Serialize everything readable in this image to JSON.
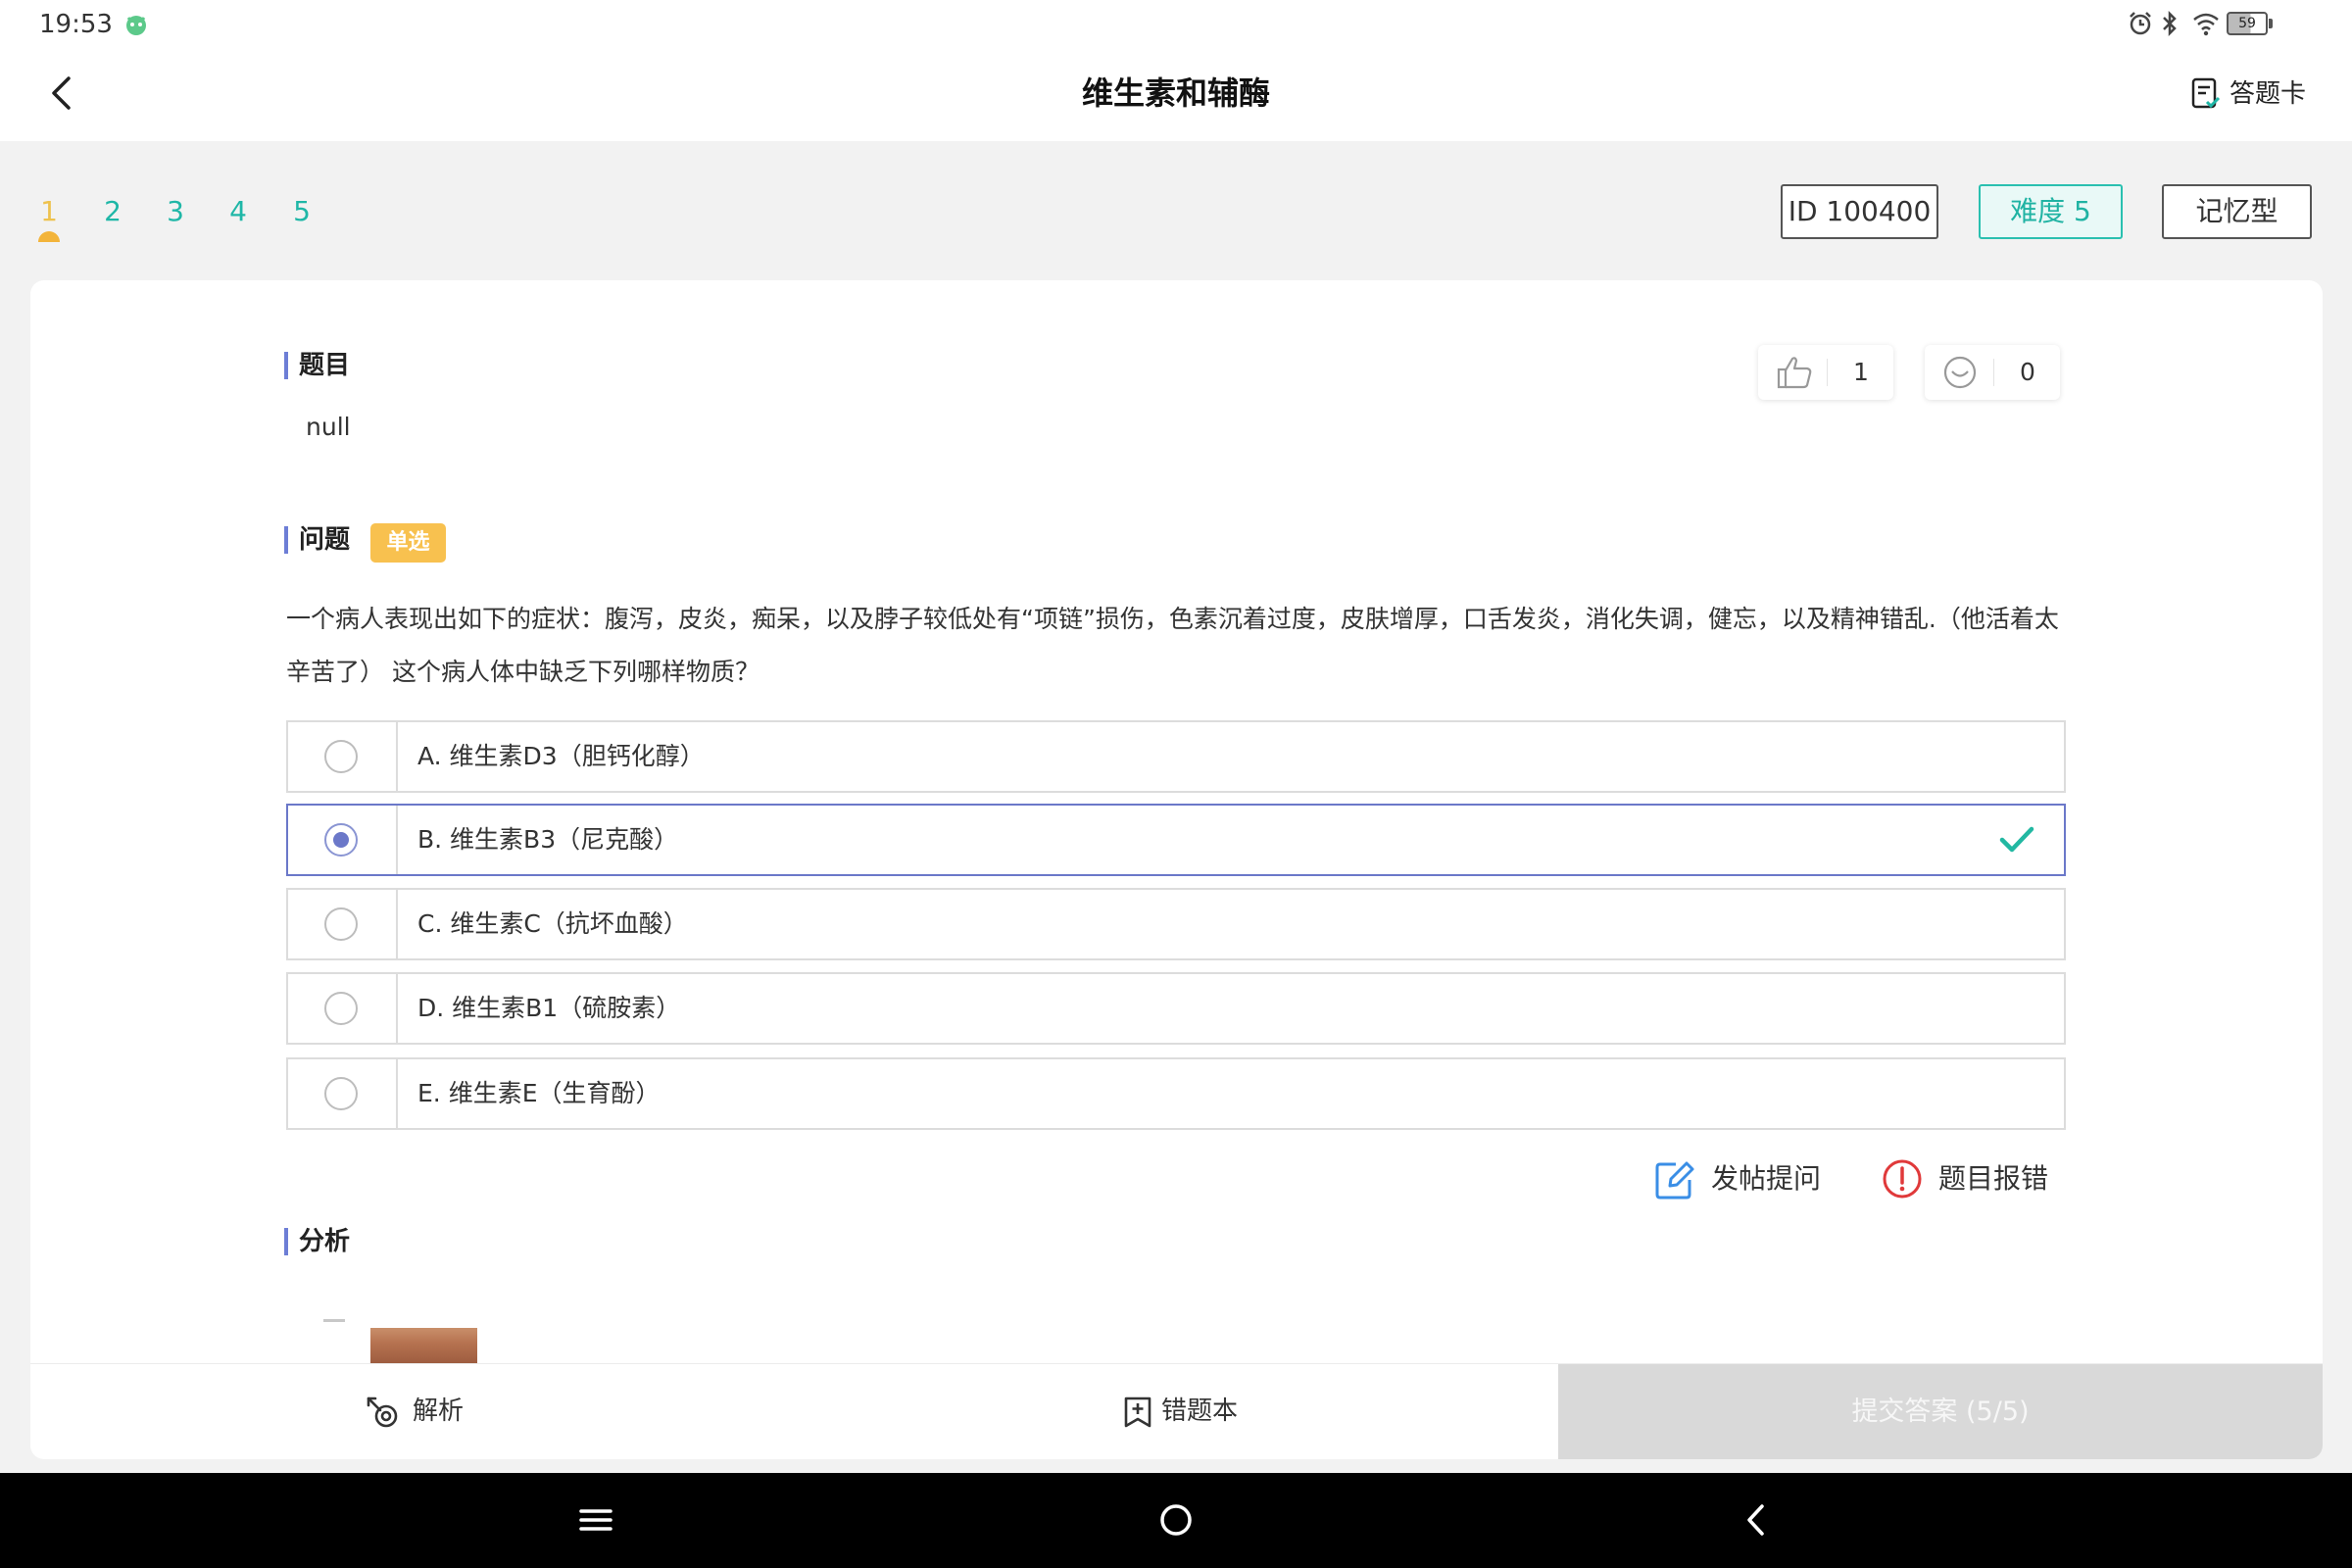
{
  "status_bar": {
    "time": "19:53",
    "battery": "59"
  },
  "header": {
    "title": "维生素和辅酶",
    "answer_card_label": "答题卡"
  },
  "question_nav": {
    "numbers": [
      "1",
      "2",
      "3",
      "4",
      "5"
    ],
    "current_index": 0
  },
  "badges": {
    "id": "ID 100400",
    "difficulty": "难度 5",
    "type": "记忆型"
  },
  "stem": {
    "label": "题目",
    "text": "null"
  },
  "reactions": {
    "likes": "1",
    "dislikes": "0"
  },
  "question": {
    "label": "问题",
    "tag": "单选",
    "text": "一个病人表现出如下的症状：腹泻，皮炎，痴呆，以及脖子较低处有“项链”损伤，色素沉着过度，皮肤增厚，口舌发炎，消化失调，健忘，以及精神错乱.（他活着太辛苦了） 这个病人体中缺乏下列哪样物质？",
    "options": [
      {
        "text": "A. 维生素D3（胆钙化醇）",
        "selected": false,
        "correct": false
      },
      {
        "text": "B. 维生素B3（尼克酸）",
        "selected": true,
        "correct": true
      },
      {
        "text": "C. 维生素C（抗坏血酸）",
        "selected": false,
        "correct": false
      },
      {
        "text": "D. 维生素B1（硫胺素）",
        "selected": false,
        "correct": false
      },
      {
        "text": "E. 维生素E（生育酚）",
        "selected": false,
        "correct": false
      }
    ]
  },
  "actions": {
    "post_question": "发帖提问",
    "report_error": "题目报错"
  },
  "analysis": {
    "label": "分析"
  },
  "bottom_bar": {
    "analysis": "解析",
    "wrong_book": "错题本",
    "submit": "提交答案 (5/5)"
  },
  "colors": {
    "accent": "#1fb7a7",
    "current_number": "#eec24e",
    "selected_border": "#6b78c9",
    "correct_check": "#22b8a2",
    "tag_bg": "#f8c14f",
    "section_bar": "#6d7ed6",
    "edit_icon": "#3a8ee6",
    "error_icon": "#e0393a",
    "submit_bg": "#d9d9d9"
  },
  "icons": [
    "back-icon",
    "answer-card-icon",
    "thumbs-up-icon",
    "smiley-icon",
    "check-icon",
    "edit-icon",
    "error-icon",
    "analysis-icon",
    "bookmark-add-icon",
    "menu-icon",
    "home-icon",
    "nav-back-icon",
    "alarm-icon",
    "bluetooth-icon",
    "wifi-icon",
    "battery-icon"
  ]
}
